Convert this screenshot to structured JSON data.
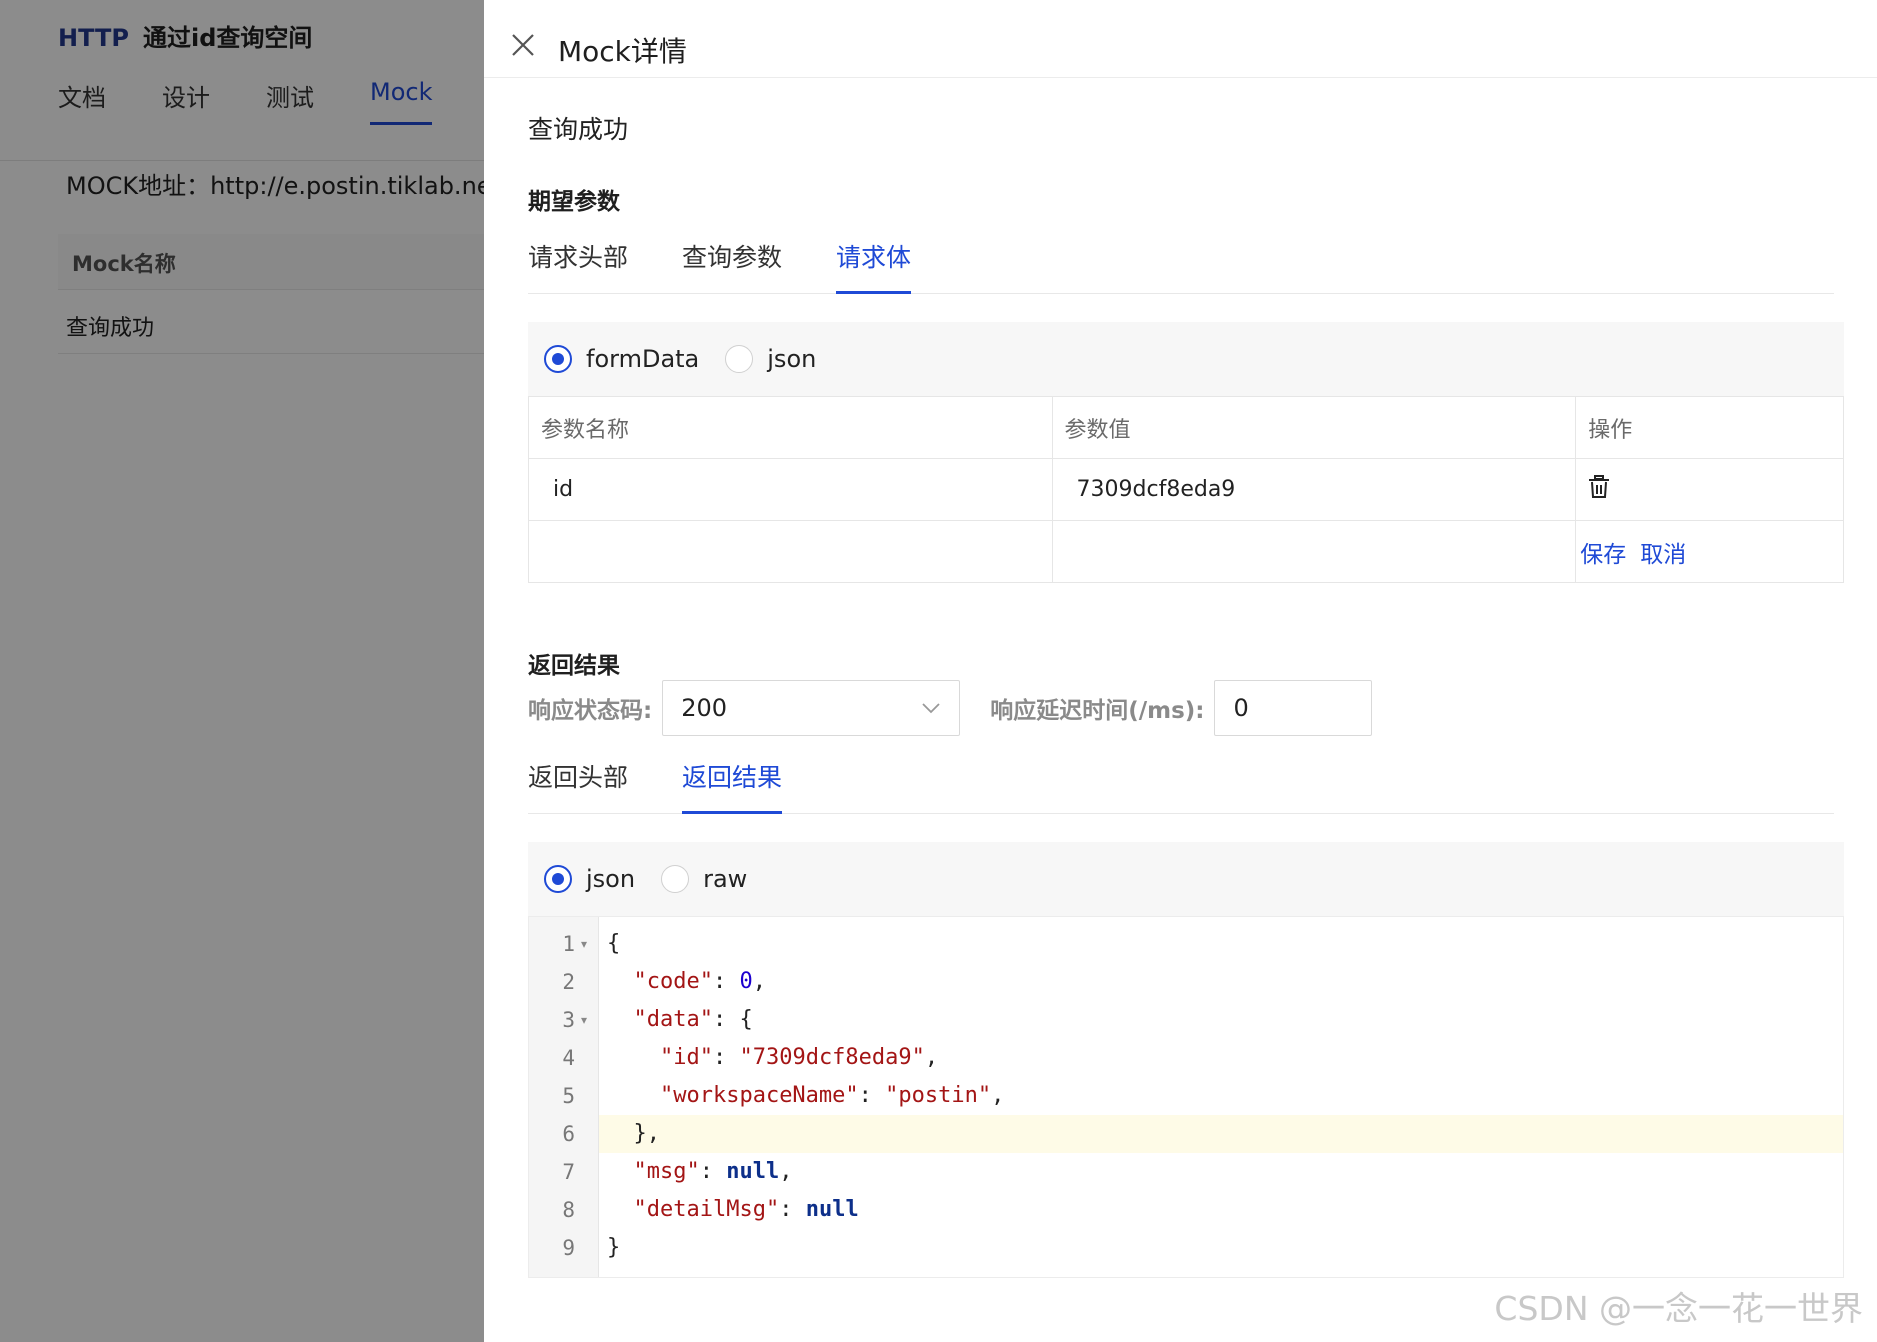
{
  "background": {
    "method": "HTTP",
    "title": "通过id查询空间",
    "tabs": [
      "文档",
      "设计",
      "测试",
      "Mock"
    ],
    "mock_url": "MOCK地址：http://e.postin.tiklab.net/m",
    "table_header": "Mock名称",
    "table_row": "查询成功"
  },
  "drawer": {
    "title": "Mock详情",
    "mock_name": "查询成功",
    "expect_title": "期望参数",
    "request_tabs": [
      "请求头部",
      "查询参数",
      "请求体"
    ],
    "request_body_types": [
      "formData",
      "json"
    ],
    "params_table": {
      "headers": [
        "参数名称",
        "参数值",
        "操作"
      ],
      "rows": [
        {
          "name": "id",
          "value": "7309dcf8eda9"
        }
      ]
    },
    "save_label": "保存",
    "cancel_label": "取消",
    "response_title": "返回结果",
    "status_label": "响应状态码:",
    "status_value": "200",
    "delay_label": "响应延迟时间(/ms):",
    "delay_value": "0",
    "response_tabs": [
      "返回头部",
      "返回结果"
    ],
    "response_types": [
      "json",
      "raw"
    ],
    "code_lines": [
      "{",
      "  \"code\": 0,",
      "  \"data\": {",
      "    \"id\": \"7309dcf8eda9\",",
      "    \"workspaceName\": \"postin\",",
      "  },",
      "  \"msg\": null,",
      "  \"detailMsg\": null",
      "}"
    ],
    "line_numbers": [
      "1",
      "2",
      "3",
      "4",
      "5",
      "6",
      "7",
      "8",
      "9"
    ]
  },
  "watermark": "CSDN @一念一花一世界",
  "colors": {
    "accent": "#1f4ad6",
    "highlight_line": "#fefbe7",
    "mask": "rgba(0,0,0,0.45)"
  }
}
